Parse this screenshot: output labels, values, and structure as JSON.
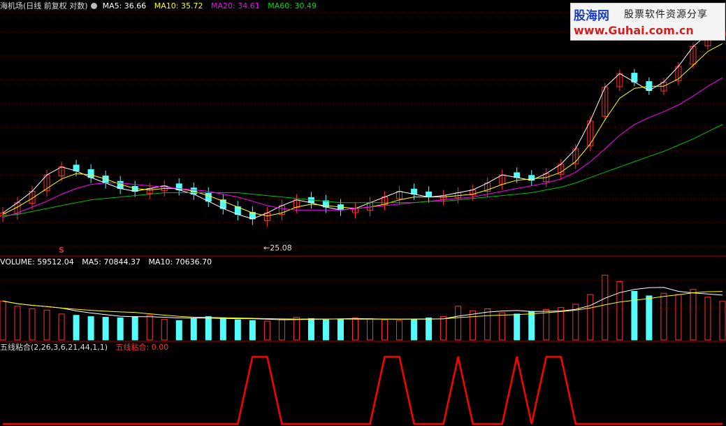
{
  "header": {
    "title": "海机场(日线 前复权 对数)",
    "ma5": "MA5: 36.66",
    "ma10": "MA10: 35.72",
    "ma20": "MA20: 34.61",
    "ma60": "MA60: 30.49"
  },
  "volume_header": {
    "volume": "VOLUME: 59512.04",
    "ma5": "MA5: 70844.37",
    "ma10": "MA10: 70636.70"
  },
  "indicator_header": {
    "name": "五线粘合(2,26,3,6,21,44,1,1)",
    "value": "五线粘合: 0.00"
  },
  "annotations": {
    "low_price": "25.08",
    "signal_mark": "S"
  },
  "watermark": {
    "logo": "股海网",
    "tagline": "股票软件资源分享",
    "url": "www.Guhai.com.cn"
  },
  "colors": {
    "up": "#ff3232",
    "down": "#54fcfc",
    "ma5": "#ffffff",
    "ma10": "#ffff00",
    "ma20": "#ff00ff",
    "ma60": "#00c000",
    "indicator": "#ff0000",
    "grid": "#8b0000"
  },
  "chart_data": [
    {
      "type": "line",
      "name": "price",
      "series": [
        {
          "name": "MA5",
          "values": [
            26.5,
            27.2,
            28.0,
            29.2,
            29.8,
            29.5,
            29.0,
            28.6,
            28.2,
            28.0,
            28.2,
            28.4,
            28.1,
            27.8,
            27.3,
            26.8,
            26.4,
            26.1,
            26.5,
            27.0,
            27.4,
            27.2,
            26.9,
            26.7,
            26.8,
            27.2,
            27.6,
            28.0,
            27.8,
            27.6,
            27.7,
            27.9,
            28.1,
            28.6,
            29.2,
            29.0,
            28.8,
            29.3,
            30.0,
            31.2,
            33.5,
            36.5,
            37.8,
            37.0,
            36.2,
            37.0,
            38.5,
            40.5,
            41.8,
            42.0
          ]
        },
        {
          "name": "MA10",
          "values": [
            26.4,
            26.9,
            27.5,
            28.2,
            28.9,
            29.3,
            29.2,
            28.9,
            28.5,
            28.2,
            28.1,
            28.2,
            28.2,
            28.0,
            27.7,
            27.3,
            26.9,
            26.5,
            26.3,
            26.5,
            26.9,
            27.1,
            27.0,
            26.9,
            26.8,
            26.9,
            27.1,
            27.4,
            27.6,
            27.6,
            27.6,
            27.7,
            27.8,
            28.1,
            28.5,
            28.8,
            28.9,
            29.0,
            29.4,
            30.2,
            31.6,
            33.6,
            35.5,
            36.4,
            36.6,
            36.6,
            37.3,
            38.6,
            40.0,
            40.8
          ]
        },
        {
          "name": "MA20",
          "values": [
            26.2,
            26.5,
            26.9,
            27.3,
            27.8,
            28.2,
            28.5,
            28.6,
            28.6,
            28.5,
            28.4,
            28.3,
            28.2,
            28.1,
            28.0,
            27.8,
            27.6,
            27.3,
            27.0,
            26.8,
            26.7,
            26.7,
            26.7,
            26.7,
            26.8,
            26.9,
            27.0,
            27.1,
            27.2,
            27.3,
            27.4,
            27.5,
            27.6,
            27.8,
            28.0,
            28.2,
            28.4,
            28.6,
            28.9,
            29.4,
            30.2,
            31.2,
            32.3,
            33.2,
            33.8,
            34.3,
            34.9,
            35.7,
            36.6,
            37.4
          ]
        },
        {
          "name": "MA60",
          "values": [
            26.3,
            26.4,
            26.6,
            26.8,
            27.0,
            27.2,
            27.4,
            27.5,
            27.6,
            27.7,
            27.8,
            27.9,
            27.9,
            27.9,
            27.9,
            27.9,
            27.9,
            27.8,
            27.7,
            27.6,
            27.5,
            27.4,
            27.3,
            27.2,
            27.2,
            27.2,
            27.2,
            27.2,
            27.2,
            27.3,
            27.3,
            27.4,
            27.5,
            27.6,
            27.7,
            27.8,
            27.9,
            28.1,
            28.3,
            28.6,
            29.0,
            29.4,
            29.8,
            30.2,
            30.6,
            31.0,
            31.5,
            32.0,
            32.6,
            33.2
          ]
        }
      ],
      "low_marker": 25.08,
      "ylim": [
        24,
        44
      ],
      "scale": "log"
    },
    {
      "type": "bar",
      "name": "volume",
      "values": [
        60000,
        52000,
        48000,
        46000,
        40000,
        38000,
        36000,
        35000,
        34000,
        36000,
        38000,
        32000,
        30000,
        33000,
        36000,
        34000,
        31000,
        30000,
        29000,
        32000,
        35000,
        33000,
        31000,
        32000,
        34000,
        33000,
        31000,
        30000,
        32000,
        34000,
        36000,
        52000,
        45000,
        48000,
        42000,
        40000,
        44000,
        47000,
        50000,
        55000,
        70000,
        100000,
        90000,
        75000,
        68000,
        72000,
        70000,
        78000,
        66000,
        59512.04
      ],
      "ylim": [
        0,
        110000
      ]
    },
    {
      "type": "line",
      "name": "五线粘合",
      "values": [
        0,
        0,
        0,
        0,
        0,
        0,
        0,
        0,
        0,
        0,
        0,
        0,
        0,
        0,
        0,
        0,
        0,
        1,
        1,
        0,
        0,
        0,
        0,
        0,
        0,
        0,
        1,
        1,
        0,
        0,
        0,
        1,
        0,
        0,
        0,
        1,
        0,
        1,
        1,
        0,
        0,
        0,
        0,
        0,
        0,
        0,
        0,
        0,
        0,
        0
      ],
      "ylim": [
        0,
        1
      ]
    }
  ]
}
